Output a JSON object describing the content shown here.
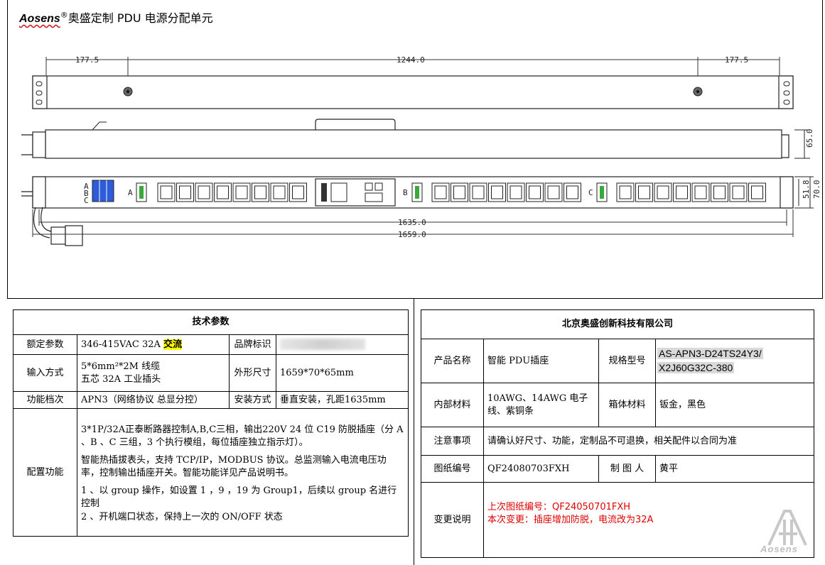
{
  "header": {
    "brand": "Aosens",
    "reg": "®",
    "title": "奥盛定制 PDU 电源分配单元"
  },
  "dims": {
    "left_offset": "177.5",
    "center_span": "1244.0",
    "right_offset": "177.5",
    "depth": "65.0",
    "width_a": "51.8",
    "width_b": "70.0",
    "mount_length": "1635.0",
    "total_length": "1659.0",
    "phase_labels": [
      "A",
      "B",
      "C"
    ]
  },
  "spec": {
    "title": "技术参数",
    "rated_label": "额定参数",
    "rated_value": "346-415VAC    32A ",
    "rated_ac": "交流",
    "brand_label": "品牌标识",
    "input_label": "输入方式",
    "input_line1": "5*6mm²*2M 线缆",
    "input_line2": "五芯 32A 工业插头",
    "size_label": "外形尺寸",
    "size_value": "1659*70*65mm",
    "func_label": "功能档次",
    "func_value": "APN3（网络协议 总显分控）",
    "install_label": "安装方式",
    "install_value": "垂直安装，孔距1635mm",
    "config_label": "配置功能",
    "config_p1": "3*1P/32A正泰断路器控制A,B,C三相，输出220V   24 位  C19 防脱插座（分 A 、B 、C 三组，3 个执行模组，每位插座独立指示灯）。",
    "config_p2": "智能热插拔表头，支持 TCP/IP，MODBUS 协议。总监测输入电流电压功率，控制输出插座开关。智能功能详见产品说明书。",
    "config_p3": "1 、以 group 操作，如设置  1 ，9 ，19 为 Group1，后续以 group 名进行控制",
    "config_p4": "2 、开机端口状态，保持上一次的 ON/OFF 状态"
  },
  "company": {
    "title": "北京奥盛创新科技有限公司",
    "product_label": "产品名称",
    "product_value": "智能 PDU插座",
    "model_label": "规格型号",
    "model_line1": "AS-APN3-D24TS24Y3/",
    "model_line2": "X2J60G32C-380",
    "material_label": "内部材料",
    "material_value": "10AWG、14AWG 电子线、紫铜条",
    "case_label": "箱体材料",
    "case_value": "钣金，黑色",
    "note_label": "注意事项",
    "note_value": "请确认好尺寸、功能，定制品不可退换，相关配件以合同为准",
    "drawing_label": "图纸编号",
    "drawing_value": "QF24080703FXH",
    "maker_label": "制  图  人",
    "maker_value": "黄平",
    "change_label": "变更说明",
    "change_line1": "上次图纸编号：QF24050701FXH",
    "change_line2": "本次变更：插座增加防脱，电流改为32A"
  },
  "logo": {
    "text": "Aosens"
  }
}
